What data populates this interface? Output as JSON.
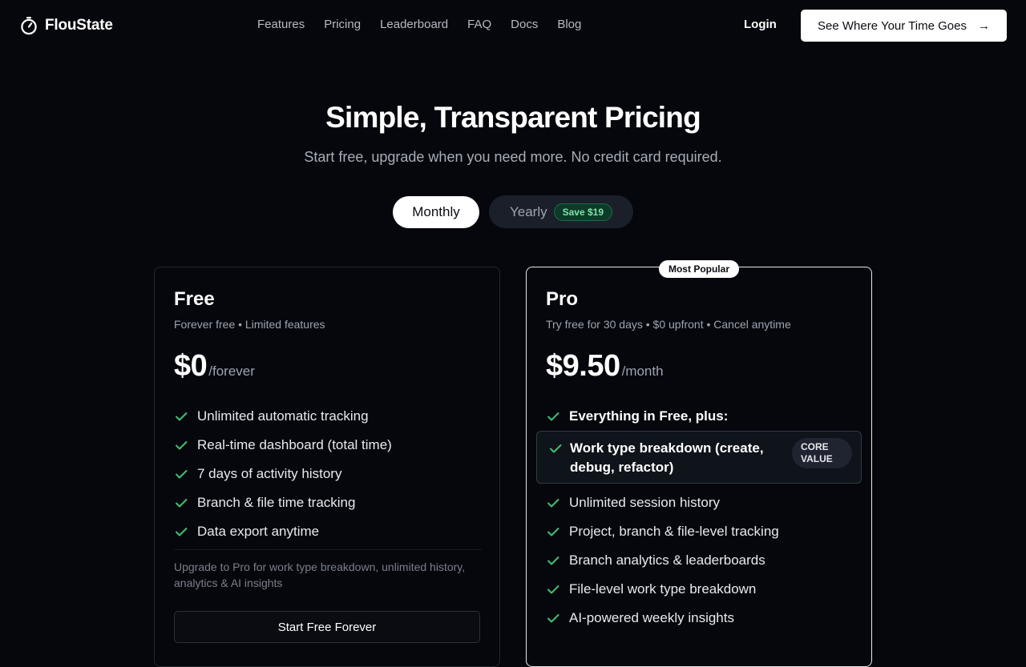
{
  "nav": {
    "brand": "FlouState",
    "links": [
      "Features",
      "Pricing",
      "Leaderboard",
      "FAQ",
      "Docs",
      "Blog"
    ],
    "login": "Login",
    "cta": "See Where Your Time Goes"
  },
  "hero": {
    "title": "Simple, Transparent Pricing",
    "subtitle": "Start free, upgrade when you need more. No credit card required."
  },
  "billing_toggle": {
    "monthly": "Monthly",
    "yearly": "Yearly",
    "save_badge": "Save $19",
    "selected": "Monthly"
  },
  "plans": {
    "free": {
      "name": "Free",
      "description": "Forever free • Limited features",
      "price": "$0",
      "period": "/forever",
      "features": [
        "Unlimited automatic tracking",
        "Real-time dashboard (total time)",
        "7 days of activity history",
        "Branch & file time tracking",
        "Data export anytime"
      ],
      "upgrade_note": "Upgrade to Pro for work type breakdown, unlimited history, analytics & AI insights",
      "button": "Start Free Forever"
    },
    "pro": {
      "badge": "Most Popular",
      "name": "Pro",
      "description": "Try free for 30 days • $0 upfront • Cancel anytime",
      "price": "$9.50",
      "period": "/month",
      "intro": "Everything in Free, plus:",
      "core_feature": "Work type breakdown (create, debug, refactor)",
      "core_badge": "CORE VALUE",
      "features": [
        "Unlimited session history",
        "Project, branch & file-level tracking",
        "Branch analytics & leaderboards",
        "File-level work type breakdown",
        "AI-powered weekly insights"
      ]
    }
  },
  "colors": {
    "background": "#05070d",
    "check": "#3fbf6f",
    "save_badge_bg": "#0d3b28",
    "save_badge_text": "#7ee2a8"
  }
}
